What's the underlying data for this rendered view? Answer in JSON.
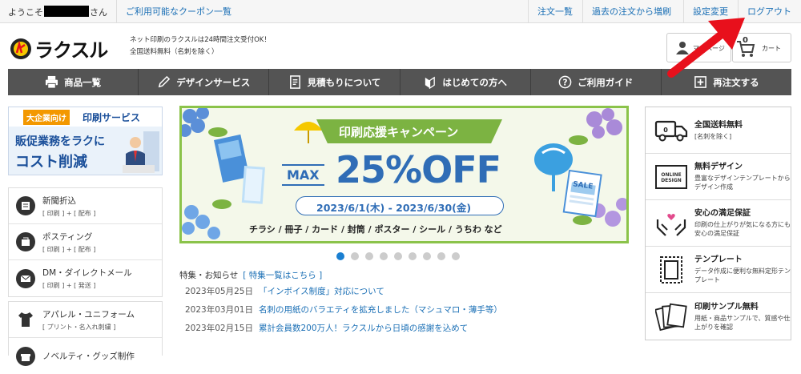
{
  "topbar": {
    "welcome_prefix": "ようこそ",
    "welcome_suffix": "さん",
    "coupon_link": "ご利用可能なクーポン一覧",
    "orders_link": "注文一覧",
    "reorder_link": "過去の注文から増刷",
    "settings_link": "設定変更",
    "logout_link": "ログアウト"
  },
  "header": {
    "logo_text": "ラクスル",
    "tagline1": "ネット印刷のラクスルは24時間注文受付OK！",
    "tagline2": "全国送料無料（名刺を除く）",
    "mypage_label": "マイページ",
    "cart_count": "0",
    "cart_label": "カート"
  },
  "nav": {
    "items": [
      {
        "label": "商品一覧",
        "icon": "printer-icon"
      },
      {
        "label": "デザインサービス",
        "icon": "pen-icon"
      },
      {
        "label": "見積もりについて",
        "icon": "document-icon"
      },
      {
        "label": "はじめての方へ",
        "icon": "beginner-mark-icon"
      },
      {
        "label": "ご利用ガイド",
        "icon": "question-icon"
      },
      {
        "label": "再注文する",
        "icon": "reorder-icon"
      }
    ]
  },
  "biz_banner": {
    "tag": "大企業向け",
    "title": "印刷サービス",
    "line1": "販促業務をラクに",
    "line2": "コスト削減"
  },
  "left_services": [
    {
      "title": "新聞折込",
      "sub": "[ 印刷 ] + [ 配布 ]"
    },
    {
      "title": "ポスティング",
      "sub": "[ 印刷 ] + [ 配布 ]"
    },
    {
      "title": "DM・ダイレクトメール",
      "sub": "[ 印刷 ] + [ 発送 ]"
    }
  ],
  "left_products": [
    {
      "title": "アパレル・ユニフォーム",
      "sub": "[ プリント・名入れ刺繍 ]"
    },
    {
      "title": "ノベルティ・グッズ制作",
      "sub": ""
    }
  ],
  "banner": {
    "campaign": "印刷応援キャンペーン",
    "max": "MAX",
    "discount": "25%OFF",
    "period": "2023/6/1(木) - 2023/6/30(金)",
    "items": "チラシ / 冊子 / カード / 封筒 / ポスター / シール / うちわ など",
    "sale_tag": "SALE"
  },
  "carousel": {
    "count": 9,
    "active": 0
  },
  "news": {
    "heading": "特集・お知らせ",
    "list_link": "[ 特集一覧はこちら ]",
    "items": [
      {
        "date": "2023年05月25日",
        "text": "「インボイス制度」対応について"
      },
      {
        "date": "2023年03月01日",
        "text": "名刺の用紙のバラエティを拡充しました（マシュマロ・薄手等）"
      },
      {
        "date": "2023年02月15日",
        "text": "累計会員数200万人！ラクスルから日頃の感謝を込めて"
      }
    ]
  },
  "features": [
    {
      "title": "全国送料無料",
      "sub": "[名刺を除く]",
      "icon": "truck-icon"
    },
    {
      "title": "無料デザイン",
      "sub": "豊富なデザインテンプレートからデザイン作成",
      "icon": "online-design-icon",
      "icon_text": "ONLINE DESIGN"
    },
    {
      "title": "安心の満足保証",
      "sub": "印刷の仕上がりが気になる方にも安心の満足保証",
      "icon": "heart-hands-icon"
    },
    {
      "title": "テンプレート",
      "sub": "データ作成に便利な無料定形テンプレート",
      "icon": "template-icon"
    },
    {
      "title": "印刷サンプル無料",
      "sub": "用紙・商品サンプルで、質感や仕上がりを確認",
      "icon": "samples-icon"
    }
  ],
  "colors": {
    "accent_blue": "#1a6fb5",
    "nav_bg": "#545454",
    "banner_green": "#8bc34a",
    "arrow_red": "#e8101c"
  }
}
